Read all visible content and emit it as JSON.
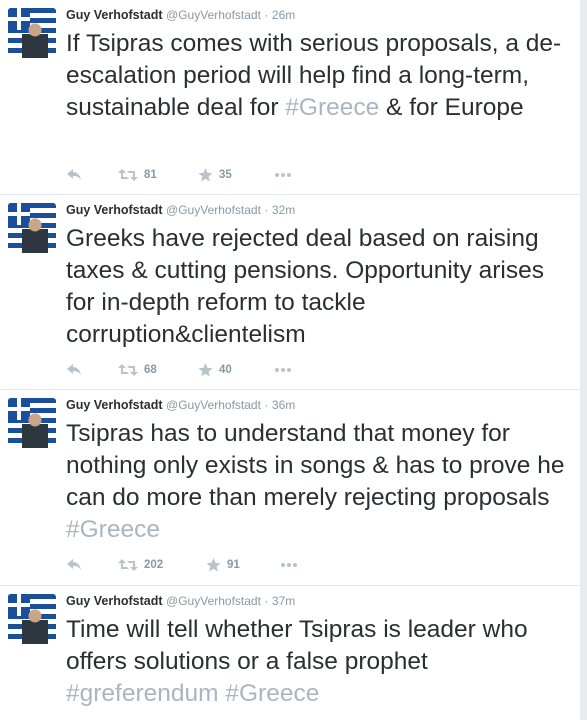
{
  "colors": {
    "hashtag": "#a9b6c1",
    "icon": "#b8c3cc",
    "name": "#292f33",
    "meta": "#8899a6"
  },
  "icons": {
    "reply": "reply-icon",
    "retweet": "retweet-icon",
    "favorite": "star-icon",
    "more": "more-icon"
  },
  "tweets": [
    {
      "author": "Guy Verhofstadt",
      "handle": "@GuyVerhofstadt",
      "time": "26m",
      "text": "If Tsipras comes with serious proposals, a de-escalation period will help find a long-term, sustainable deal for ",
      "hashtag": "#Greece",
      "tail": " & for Europe",
      "retweets": "81",
      "favorites": "35"
    },
    {
      "author": "Guy Verhofstadt",
      "handle": "@GuyVerhofstadt",
      "time": "32m",
      "text": "Greeks have rejected deal based on raising taxes & cutting pensions. Opportunity arises for in-depth reform to tackle corruption&clientelism",
      "retweets": "68",
      "favorites": "40"
    },
    {
      "author": "Guy Verhofstadt",
      "handle": "@GuyVerhofstadt",
      "time": "36m",
      "text": "Tsipras has to understand that money for nothing only exists in songs & has to prove he can do more than merely rejecting proposals ",
      "hashtag": "#Greece",
      "retweets": "202",
      "favorites": "91"
    },
    {
      "author": "Guy Verhofstadt",
      "handle": "@GuyVerhofstadt",
      "time": "37m",
      "text": "Time will tell whether Tsipras is leader who offers solutions or a false prophet ",
      "hashtag": "#greferendum",
      "hashtag2": "#Greece"
    }
  ]
}
